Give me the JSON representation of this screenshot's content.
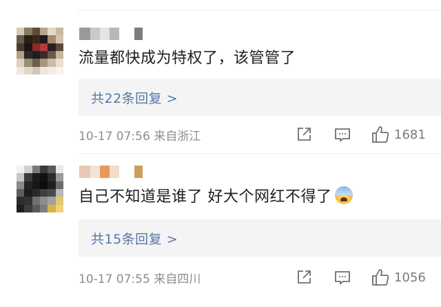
{
  "comments": [
    {
      "text": "流量都快成为特权了，该管管了",
      "reply_summary": "共22条回复 >",
      "timestamp": "10-17 07:56 来自浙江",
      "likes": "1681",
      "avatar_colors": [
        "#d8c9b6",
        "#8a7a62",
        "#5d4c3a",
        "#b7a58f",
        "#e6d9c7",
        "#c9b9a3",
        "#6a5a45",
        "#2b1f16",
        "#3a2619",
        "#1b1b1b",
        "#a38a6a",
        "#d4c4ae",
        "#4a3a2b",
        "#1c1616",
        "#8a2a2a",
        "#b53a3a",
        "#2a2020",
        "#5c4b3b",
        "#b0a08a",
        "#2a2a2a",
        "#1e1e1e",
        "#3b2a2a",
        "#6b5a4a",
        "#c7b6a0",
        "#ddd0bf",
        "#9c8b76",
        "#6e5e4c",
        "#a89680",
        "#cbbca8",
        "#e9dfd2",
        "#f0e8de",
        "#e2d7c9",
        "#d3c5b4",
        "#efe7dd",
        "#f3ede6",
        "#f7f3ee"
      ],
      "username_colors": [
        "#9a9a9a",
        "#c9c9c9",
        "#e4e4e4",
        "#b8b8b8",
        "#ffffff",
        "#7d7d7d"
      ]
    },
    {
      "text": "自己不知道是谁了  好大个网红不得了",
      "reply_summary": "共15条回复 >",
      "timestamp": "10-17 07:55 来自四川",
      "likes": "1056",
      "has_emoji": true,
      "emoji_name": "fearful-face-emoji",
      "avatar_colors": [
        "#f2f2f2",
        "#d0d0d0",
        "#7a7a7a",
        "#3a3a3a",
        "#5a5a5a",
        "#e8e8e8",
        "#c8c8c8",
        "#3c3c3c",
        "#1a1a1a",
        "#111111",
        "#2b2b2b",
        "#9a9a9a",
        "#8a8a8a",
        "#242424",
        "#161616",
        "#0d0d0d",
        "#1f1f1f",
        "#6a6a6a",
        "#5d5d5d",
        "#1d1d1d",
        "#2a2a2a",
        "#3f3f3f",
        "#4a4a4a",
        "#b9b9b9",
        "#2e2e2e",
        "#333333",
        "#6f6f6f",
        "#8d8d8d",
        "#a0a0a0",
        "#e0c870",
        "#1e1e1e",
        "#3d3d3d",
        "#5a5a5a",
        "#7e7e7e",
        "#d9b04a",
        "#f0d27a"
      ],
      "username_colors": [
        "#e8c9b8",
        "#f3e3d8",
        "#e79a5c",
        "#f7dcc6",
        "#ffffff",
        "#c9a05a"
      ]
    }
  ],
  "icons": {
    "share": "share-icon",
    "reply": "comment-icon",
    "like": "thumbs-up-icon"
  },
  "colors": {
    "link": "#5577a8",
    "meta": "#8d8d8d",
    "reply_box": "#f4f4f4"
  }
}
